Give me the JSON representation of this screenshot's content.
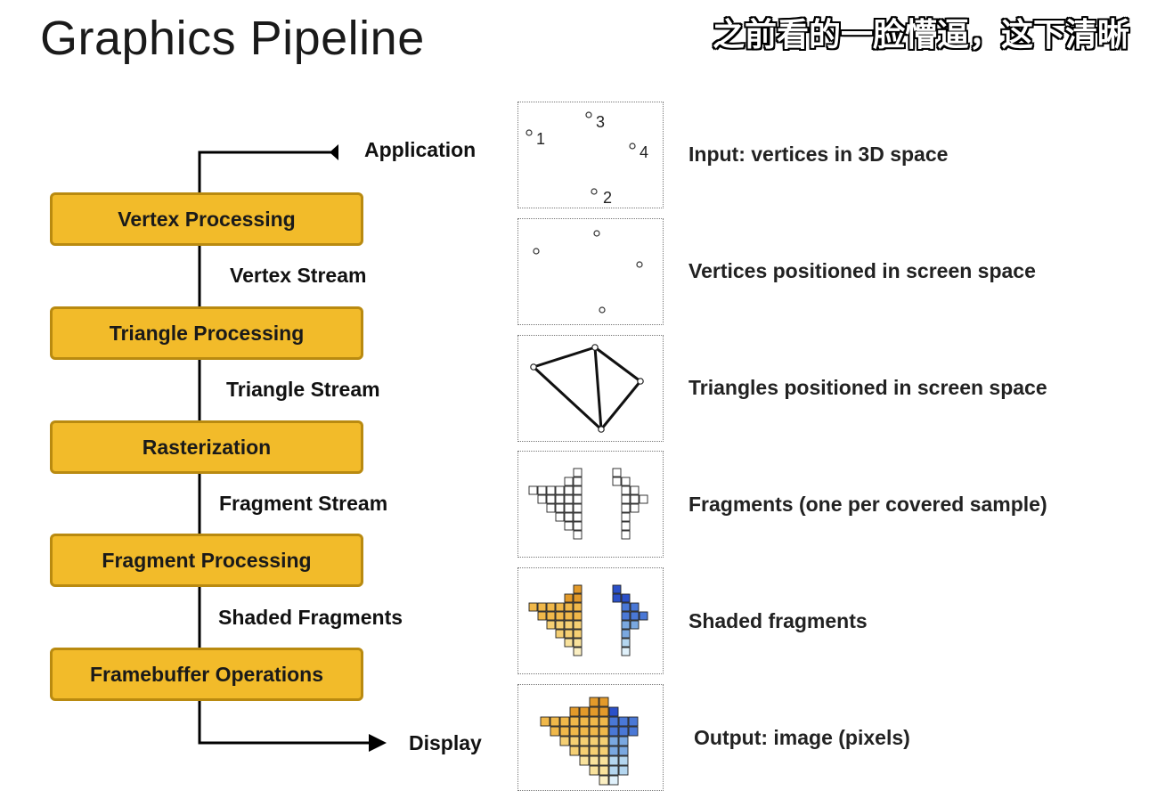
{
  "title": "Graphics Pipeline",
  "subtitle": "之前看的一脸懵逼，这下清晰",
  "stages": [
    "Vertex Processing",
    "Triangle Processing",
    "Rasterization",
    "Fragment Processing",
    "Framebuffer Operations"
  ],
  "streams": {
    "application": "Application",
    "vertex": "Vertex Stream",
    "triangle": "Triangle Stream",
    "fragment": "Fragment Stream",
    "shaded": "Shaded Fragments",
    "display": "Display"
  },
  "descriptions": [
    "Input: vertices in 3D space",
    "Vertices positioned in screen space",
    "Triangles positioned in screen space",
    "Fragments (one per covered sample)",
    "Shaded fragments",
    "Output: image (pixels)"
  ],
  "vertex_labels": [
    "1",
    "2",
    "3",
    "4"
  ],
  "colors": {
    "stage_fill": "#f2bb2a",
    "stage_border": "#b98a10",
    "orange_shades": [
      "#e39a2a",
      "#f0b84a",
      "#f5cf73",
      "#f9e29c",
      "#fbefc2"
    ],
    "blue_shades": [
      "#2b50c8",
      "#4a78d6",
      "#7aa8e0",
      "#b4d6ef",
      "#e0f1fb"
    ]
  }
}
